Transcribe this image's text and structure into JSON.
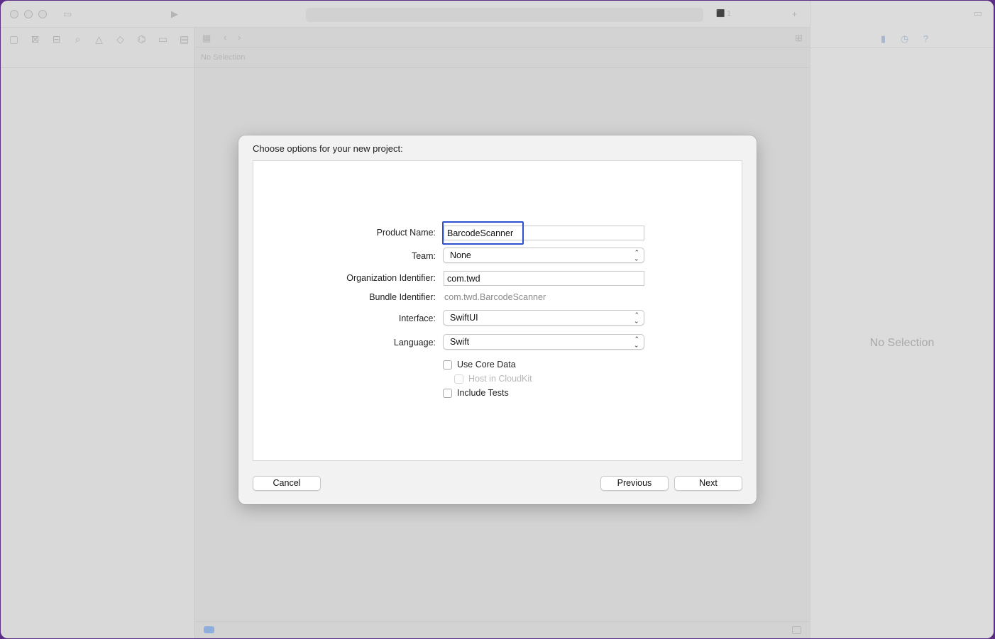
{
  "window": {
    "toolbar_badge": "1",
    "editor_path": "No Selection"
  },
  "inspector": {
    "no_selection": "No Selection"
  },
  "sheet": {
    "title": "Choose options for your new project:",
    "product_name": {
      "label": "Product Name:",
      "value": "BarcodeScanner"
    },
    "team": {
      "label": "Team:",
      "value": "None"
    },
    "org_identifier": {
      "label": "Organization Identifier:",
      "value": "com.twd"
    },
    "bundle_identifier": {
      "label": "Bundle Identifier:",
      "value": "com.twd.BarcodeScanner"
    },
    "interface": {
      "label": "Interface:",
      "value": "SwiftUI"
    },
    "language": {
      "label": "Language:",
      "value": "Swift"
    },
    "use_core_data": {
      "label": "Use Core Data",
      "checked": false
    },
    "host_in_cloudkit": {
      "label": "Host in CloudKit",
      "checked": false,
      "disabled": true
    },
    "include_tests": {
      "label": "Include Tests",
      "checked": false
    },
    "buttons": {
      "cancel": "Cancel",
      "previous": "Previous",
      "next": "Next"
    }
  },
  "colors": {
    "focus_ring": "#2f4fd1",
    "desktop": "#5b2d86"
  }
}
